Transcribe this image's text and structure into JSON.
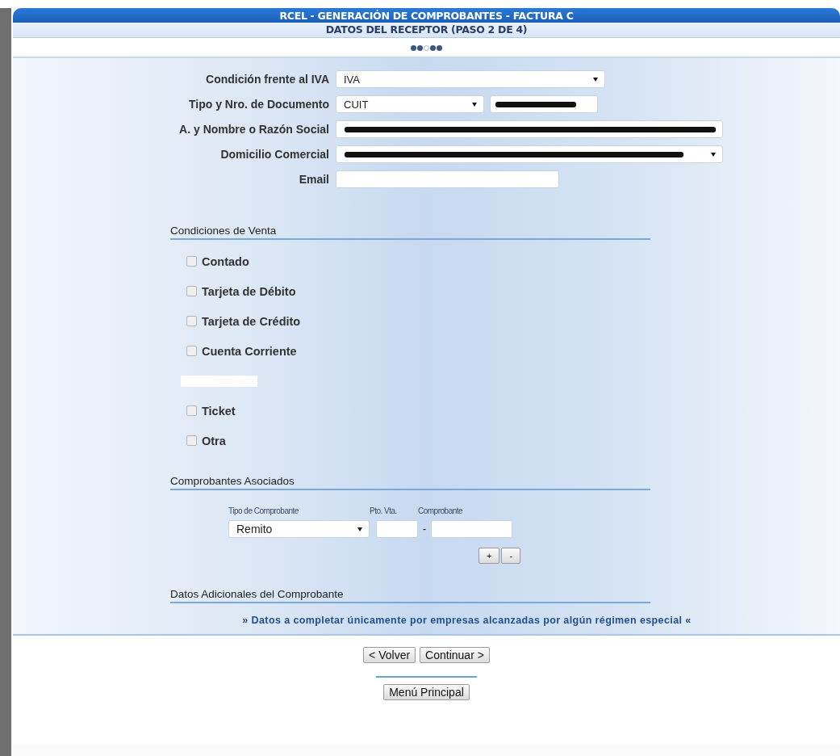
{
  "header": {
    "title": "RCEL - GENERACIÓN DE COMPROBANTES - FACTURA C",
    "subtitle": "DATOS DEL RECEPTOR (PASO 2 DE 4)"
  },
  "steps": [
    {
      "selected": false
    },
    {
      "selected": false
    },
    {
      "selected": true
    },
    {
      "selected": false
    },
    {
      "selected": false
    }
  ],
  "receptor_fields": [
    {
      "label": "Condición frente al IVA",
      "kind": "select",
      "value": "IVA"
    },
    {
      "label": "Tipo y Nro. de Documento",
      "kind": "select_input",
      "value": "CUIT",
      "redacted": true
    },
    {
      "label": "A. y Nombre o Razón Social",
      "kind": "input",
      "redacted": true
    },
    {
      "label": "Domicilio Comercial",
      "kind": "select",
      "redacted": true
    },
    {
      "label": "Email",
      "kind": "input"
    }
  ],
  "condiciones_de_venta": {
    "title": "Condiciones de Venta",
    "options": [
      {
        "label": "Contado",
        "checked": false
      },
      {
        "label": "Tarjeta de Débito",
        "checked": false
      },
      {
        "label": "Tarjeta de Crédito",
        "checked": false
      },
      {
        "label": "Cuenta Corriente",
        "checked": false
      },
      {
        "redacted": true
      },
      {
        "label": "Ticket",
        "checked": false
      },
      {
        "label": "Otra",
        "checked": false
      }
    ]
  },
  "comprobantes_asociados": {
    "title": "Comprobantes Asociados",
    "columns": [
      "Tipo de Comprobante",
      "Pto. Vta.",
      "Comprobante"
    ],
    "tipo": "Remito",
    "separator": "-",
    "buttons": [
      "+",
      "-"
    ]
  },
  "datos_adicionales": {
    "title": "Datos Adicionales del Comprobante",
    "note": "» Datos a completar únicamente por empresas alcanzadas por algún régimen especial «"
  },
  "nav_buttons": [
    "< Volver",
    "Continuar >"
  ],
  "menu_button": "Menú Principal"
}
